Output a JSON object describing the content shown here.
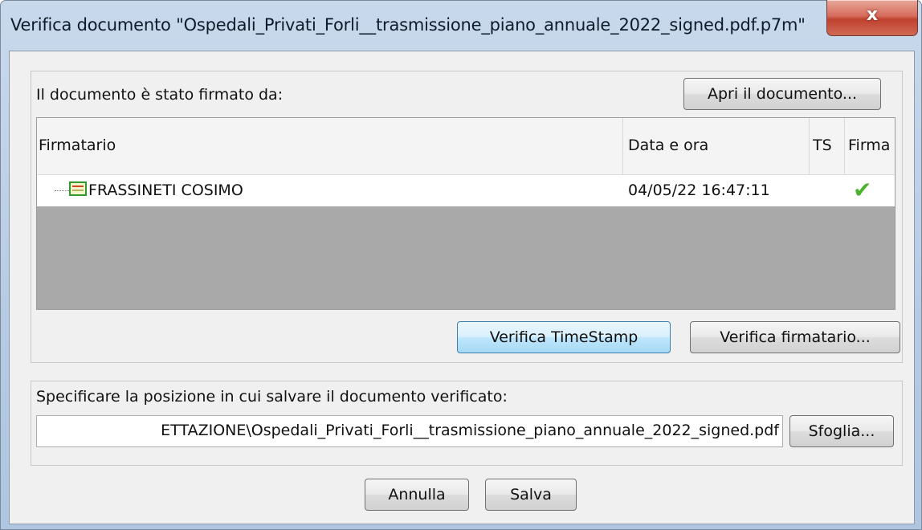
{
  "window": {
    "title": "Verifica documento \"Ospedali_Privati_Forli__trasmissione_piano_annuale_2022_signed.pdf.p7m\"",
    "close_label": "x"
  },
  "signers": {
    "heading": "Il documento è stato firmato da:",
    "open_button": "Apri il documento...",
    "columns": [
      "Firmatario",
      "Data e ora",
      "TS",
      "Firma"
    ],
    "rows": [
      {
        "name": "FRASSINETI COSIMO",
        "datetime": "04/05/22 16:47:11",
        "ts": "",
        "signature_ok": "✔"
      }
    ],
    "verify_timestamp_button": "Verifica TimeStamp",
    "verify_signer_button": "Verifica firmatario..."
  },
  "save": {
    "heading": "Specificare la posizione in cui salvare il documento verificato:",
    "path_value": "ETTAZIONE\\Ospedali_Privati_Forli__trasmissione_piano_annuale_2022_signed.pdf",
    "browse_button": "Sfoglia..."
  },
  "footer": {
    "cancel_button": "Annulla",
    "save_button": "Salva"
  },
  "colors": {
    "titlebar": "#b6cbe3",
    "close_button": "#c0412f",
    "check_mark": "#4cb32e",
    "focused_button": "#bee6fd"
  },
  "icons": [
    "close-icon",
    "certificate-icon",
    "check-icon"
  ]
}
